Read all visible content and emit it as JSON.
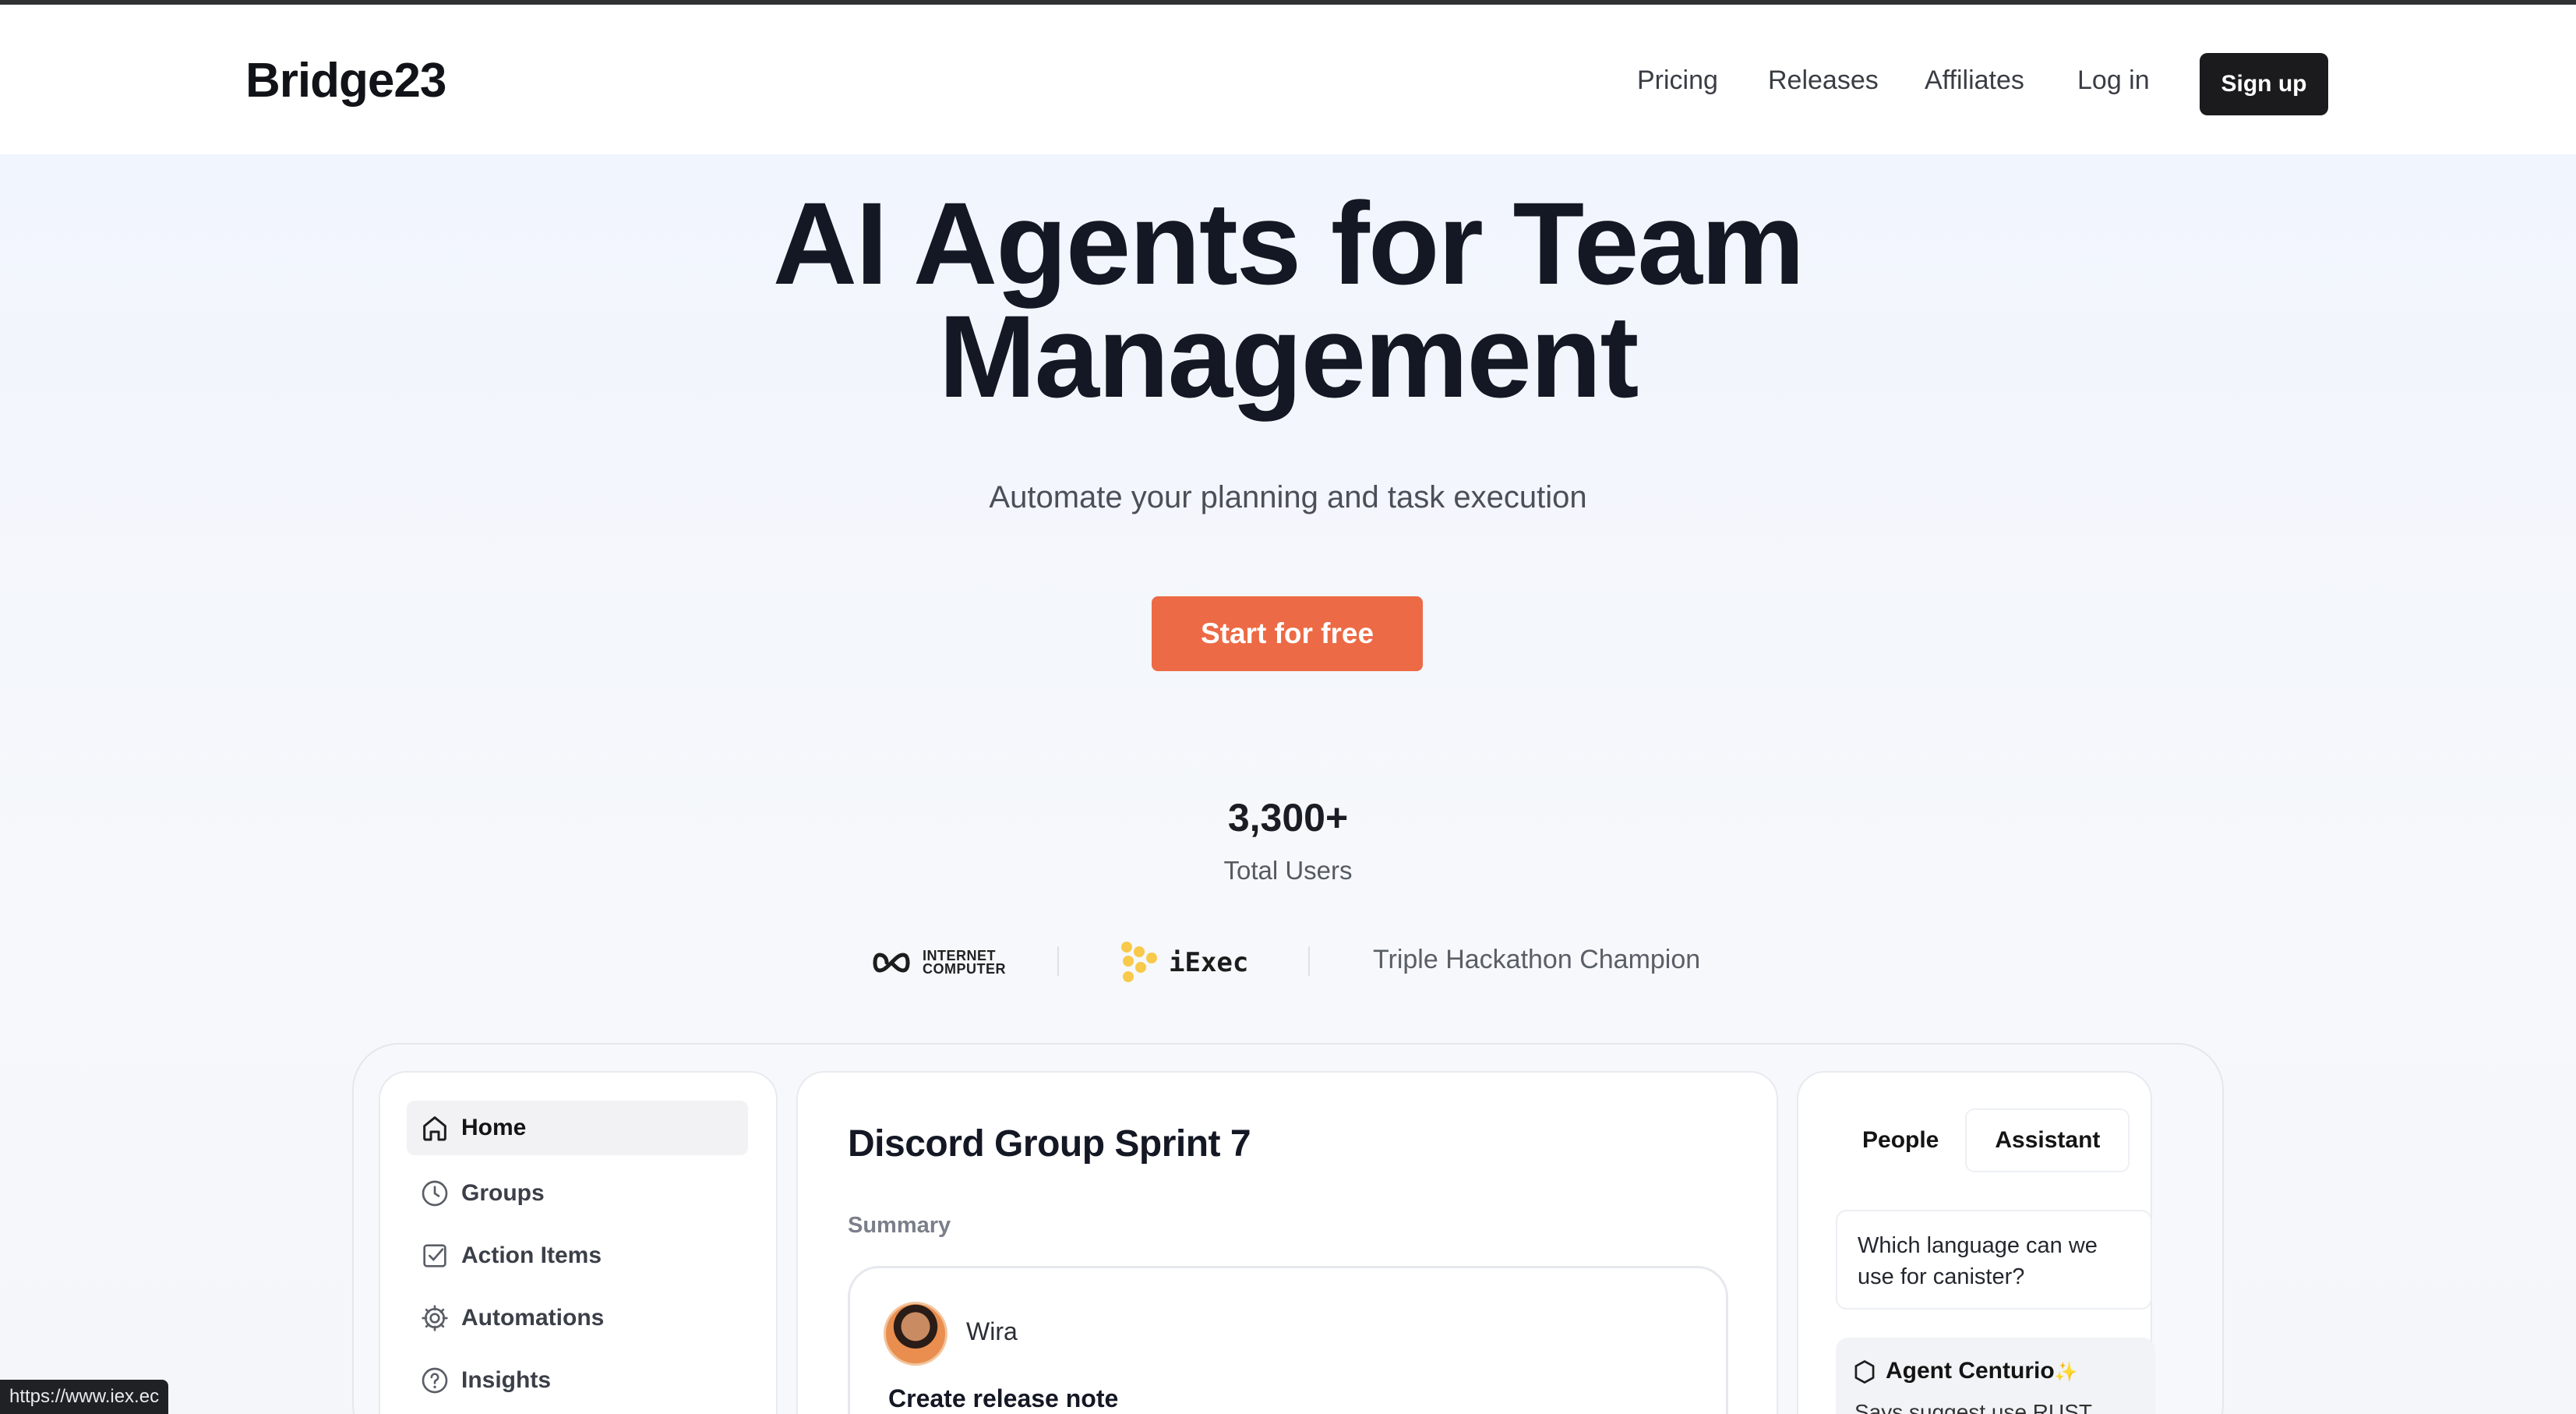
{
  "header": {
    "brand": "Bridge23",
    "nav": [
      "Pricing",
      "Releases",
      "Affiliates",
      "Log in"
    ],
    "signup_label": "Sign up"
  },
  "hero": {
    "title_line1": "AI Agents for Team",
    "title_line2": "Management",
    "subtitle": "Automate your planning and task execution",
    "cta_label": "Start for free",
    "stat_value": "3,300+",
    "stat_label": "Total Users"
  },
  "partners": {
    "ic_line1": "INTERNET",
    "ic_line2": "COMPUTER",
    "iexec": "iExec",
    "award": "Triple Hackathon Champion"
  },
  "app": {
    "sidebar": [
      {
        "label": "Home",
        "icon": "home-icon"
      },
      {
        "label": "Groups",
        "icon": "clock-icon"
      },
      {
        "label": "Action Items",
        "icon": "check-square-icon"
      },
      {
        "label": "Automations",
        "icon": "gear-icon"
      },
      {
        "label": "Insights",
        "icon": "help-circle-icon"
      }
    ],
    "main": {
      "title": "Discord Group Sprint 7",
      "summary_label": "Summary",
      "card_name": "Wira",
      "card_task": "Create release note"
    },
    "right": {
      "tabs": [
        "People",
        "Assistant"
      ],
      "question": "Which language can we use for canister?",
      "agent_name": "Agent Centurio",
      "agent_message": "Says suggest use RUST"
    }
  },
  "status_bar": {
    "url": "https://www.iex.ec"
  },
  "colors": {
    "accent": "#ec6a45",
    "dark_button": "#1b1b1d",
    "hero_bg": "#f1f5fd"
  }
}
